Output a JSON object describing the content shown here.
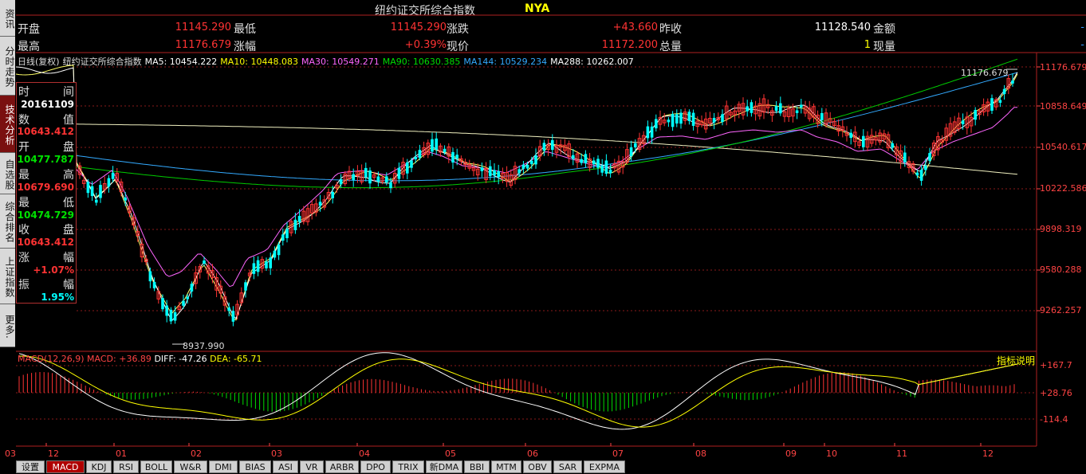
{
  "title": "纽约证交所综合指数",
  "code": "NYA",
  "sidebar": [
    {
      "label": "资讯",
      "active": false
    },
    {
      "label": "分时走势",
      "active": false
    },
    {
      "label": "技术分析",
      "active": true
    },
    {
      "label": "自选股",
      "active": false
    },
    {
      "label": "综合排名",
      "active": false
    },
    {
      "label": "上证指数",
      "active": false
    },
    {
      "label": "更多.",
      "active": false
    }
  ],
  "quote": {
    "open_label": "开盘",
    "open": "11145.290",
    "low_label": "最低",
    "low": "11145.290",
    "change_label": "涨跌",
    "change": "+43.660",
    "prev_label": "昨收",
    "prev": "11128.540",
    "amount_label": "金额",
    "amount": "-",
    "high_label": "最高",
    "high": "11176.679",
    "pct_label": "涨幅",
    "pct": "+0.39%",
    "price_label": "现价",
    "price": "11172.200",
    "totalvol_label": "总量",
    "totalvol": "1",
    "curvol_label": "现量",
    "curvol": "-"
  },
  "ma": {
    "prefix": "日线(复权)",
    "name": "纽约证交所综合指数",
    "items": [
      {
        "text": "MA5: 10454.222",
        "color": "#ffffff"
      },
      {
        "text": "MA10: 10448.083",
        "color": "#ffff00"
      },
      {
        "text": "MA30: 10549.271",
        "color": "#ff66ff"
      },
      {
        "text": "MA90: 10630.385",
        "color": "#00dd00"
      },
      {
        "text": "MA144: 10529.234",
        "color": "#33aaff"
      },
      {
        "text": "MA288: 10262.007",
        "color": "#ffffff"
      }
    ]
  },
  "info": {
    "time_a": "时",
    "time_b": "间",
    "time_v": "20161109",
    "num_a": "数",
    "num_b": "值",
    "num_v": "10643.412",
    "open_a": "开",
    "open_b": "盘",
    "open_v": "10477.787",
    "high_a": "最",
    "high_b": "高",
    "high_v": "10679.690",
    "low_a": "最",
    "low_b": "低",
    "low_v": "10474.729",
    "close_a": "收",
    "close_b": "盘",
    "close_v": "10643.412",
    "chg_a": "涨",
    "chg_b": "幅",
    "chg_v": "+1.07%",
    "amp_a": "振",
    "amp_b": "幅",
    "amp_v": "1.95%"
  },
  "annotations": {
    "max_label": "11176.679",
    "min_label": "8937.990"
  },
  "macd": {
    "name": "MACD(12,26,9)",
    "macd": "MACD: +36.89",
    "diff": "DIFF: -47.26",
    "dea": "DEA: -65.71",
    "help": "指标说明"
  },
  "chart_data": {
    "type": "candlestick",
    "y_ticks": [
      "11176.679",
      "10858.649",
      "10540.617",
      "10222.586",
      "9898.319",
      "9580.288",
      "9262.257"
    ],
    "macd_ticks": [
      "+167.7",
      "+28.76",
      "-114.4"
    ],
    "x_ticks": [
      "03",
      "12",
      "01",
      "02",
      "03",
      "04",
      "05",
      "06",
      "07",
      "08",
      "09",
      "10",
      "11",
      "12"
    ],
    "ylim": [
      8900,
      11300
    ],
    "last_close": 11172.2
  },
  "tabs": [
    "设置",
    "MACD",
    "KDJ",
    "RSI",
    "BOLL",
    "W&R",
    "DMI",
    "BIAS",
    "ASI",
    "VR",
    "ARBR",
    "DPO",
    "TRIX",
    "新DMA",
    "BBI",
    "MTM",
    "OBV",
    "SAR",
    "EXPMA"
  ],
  "active_tab": "MACD"
}
